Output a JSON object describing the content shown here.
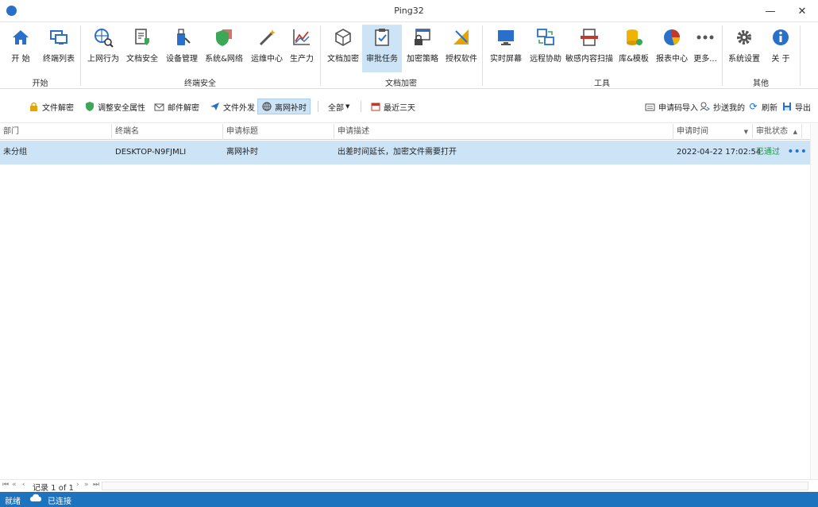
{
  "window": {
    "title": "Ping32",
    "minimize": "—",
    "maximize": "☐",
    "close": "✕"
  },
  "ribbon": {
    "groups": [
      {
        "label": "开始"
      },
      {
        "label": "终端安全"
      },
      {
        "label": "文档加密"
      },
      {
        "label": "工具"
      },
      {
        "label": "其他"
      }
    ],
    "buttons": [
      {
        "label": "开 始",
        "icon": "home-icon"
      },
      {
        "label": "终端列表",
        "icon": "monitors-icon"
      },
      {
        "label": "上网行为",
        "icon": "globe-search-icon"
      },
      {
        "label": "文档安全",
        "icon": "doc-shield-icon"
      },
      {
        "label": "设备管理",
        "icon": "usb-icon"
      },
      {
        "label": "系统&网络",
        "icon": "shield-wall-icon"
      },
      {
        "label": "运维中心",
        "icon": "wand-icon"
      },
      {
        "label": "生产力",
        "icon": "line-chart-icon"
      },
      {
        "label": "文档加密",
        "icon": "cube-icon"
      },
      {
        "label": "审批任务",
        "icon": "clipboard-check-icon"
      },
      {
        "label": "加密策略",
        "icon": "lock-window-icon"
      },
      {
        "label": "授权软件",
        "icon": "ruler-icon"
      },
      {
        "label": "实时屏幕",
        "icon": "screen-icon"
      },
      {
        "label": "远程协助",
        "icon": "remote-icon"
      },
      {
        "label": "敏感内容扫描",
        "icon": "scan-doc-icon"
      },
      {
        "label": "库&模板",
        "icon": "database-icon"
      },
      {
        "label": "报表中心",
        "icon": "pie-chart-icon"
      },
      {
        "label": "更多...",
        "icon": "more-dots-icon"
      },
      {
        "label": "系统设置",
        "icon": "gear-icon"
      },
      {
        "label": "关 于",
        "icon": "info-icon"
      }
    ]
  },
  "toolbar": {
    "left": [
      {
        "label": "文件解密",
        "icon": "lock-icon"
      },
      {
        "label": "调整安全属性",
        "icon": "shield-icon"
      },
      {
        "label": "邮件解密",
        "icon": "mail-icon"
      },
      {
        "label": "文件外发",
        "icon": "send-icon"
      },
      {
        "label": "离网补时",
        "icon": "globe-icon"
      }
    ],
    "filter": "全部",
    "date_range": "最近三天",
    "right": [
      {
        "label": "申请码导入",
        "icon": "keyboard-icon"
      },
      {
        "label": "抄送我的",
        "icon": "cc-icon"
      },
      {
        "label": "刷新",
        "icon": "refresh-icon"
      },
      {
        "label": "导出",
        "icon": "save-icon"
      }
    ]
  },
  "grid": {
    "columns": [
      "部门",
      "终端名",
      "申请标题",
      "申请描述",
      "申请时间",
      "审批状态"
    ],
    "rows": [
      {
        "dept": "未分组",
        "terminal": "DESKTOP-N9FJMLI",
        "title": "离网补时",
        "desc": "出差时间延长，加密文件需要打开",
        "time": "2022-04-22 17:02:54",
        "status": "已通过"
      }
    ]
  },
  "pager": {
    "text": "记录 1 of 1"
  },
  "status": {
    "ready": "就绪",
    "connection": "已连接"
  },
  "colors": {
    "accent": "#1e73be",
    "selection": "#cde4f7",
    "approved": "#1a9a3c"
  }
}
